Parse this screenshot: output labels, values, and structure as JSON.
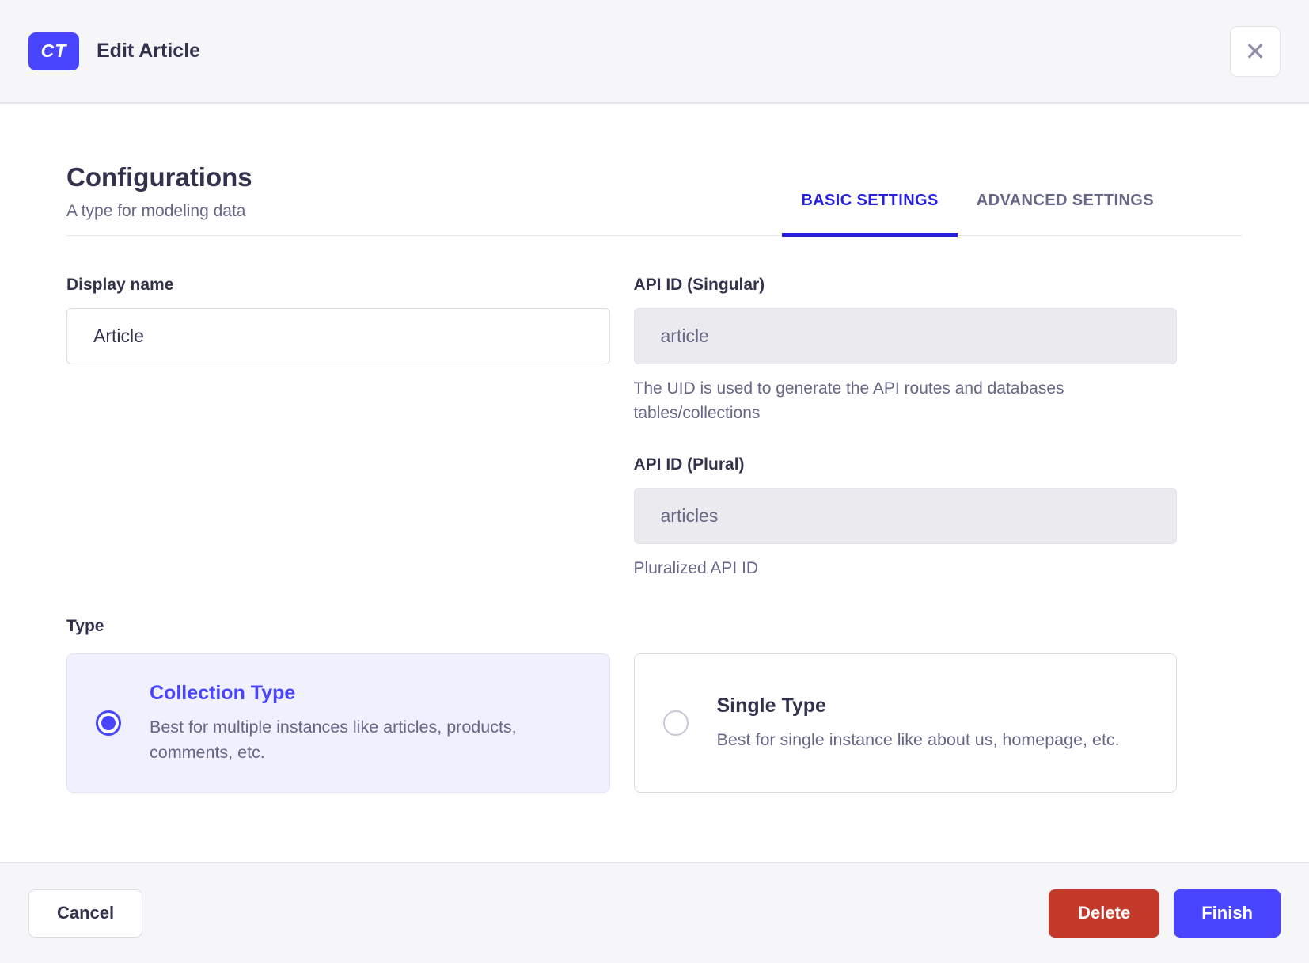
{
  "header": {
    "badge": "CT",
    "title": "Edit Article",
    "close_icon": "✕"
  },
  "section": {
    "title": "Configurations",
    "subtitle": "A type for modeling data"
  },
  "tabs": [
    {
      "label": "BASIC SETTINGS",
      "active": true
    },
    {
      "label": "ADVANCED SETTINGS",
      "active": false
    }
  ],
  "form": {
    "display_name": {
      "label": "Display name",
      "value": "Article"
    },
    "api_id_singular": {
      "label": "API ID (Singular)",
      "value": "article",
      "hint": "The UID is used to generate the API routes and databases tables/collections"
    },
    "api_id_plural": {
      "label": "API ID (Plural)",
      "value": "articles",
      "hint": "Pluralized API ID"
    },
    "type": {
      "label": "Type",
      "options": [
        {
          "title": "Collection Type",
          "description": "Best for multiple instances like articles, products, comments, etc.",
          "selected": true
        },
        {
          "title": "Single Type",
          "description": "Best for single instance like about us, homepage, etc.",
          "selected": false
        }
      ]
    }
  },
  "footer": {
    "cancel_label": "Cancel",
    "delete_label": "Delete",
    "finish_label": "Finish"
  },
  "colors": {
    "primary": "#4945ff",
    "tab_active": "#271fe0",
    "danger": "#c4392a",
    "text_dark": "#32324d",
    "text_muted": "#666687",
    "selected_card_bg": "#f0f0ff",
    "chrome_bg": "#f6f6f9"
  }
}
